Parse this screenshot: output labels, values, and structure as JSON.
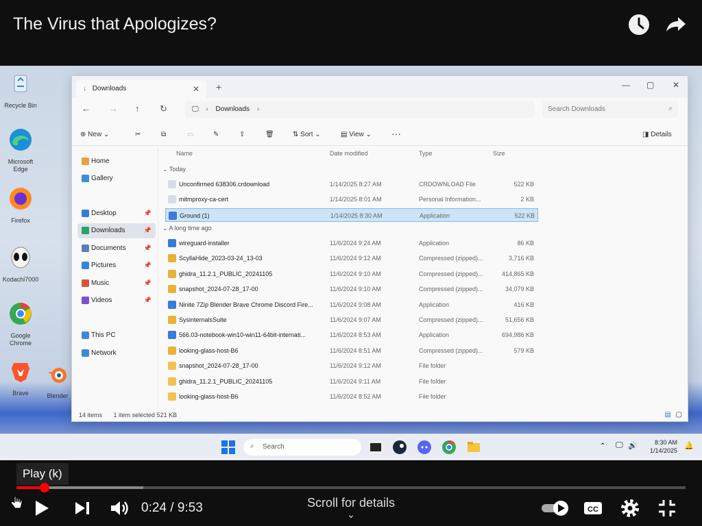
{
  "player": {
    "title": "The Virus that Apologizes?",
    "tooltip": "Play (k)",
    "time": "0:24 / 9:53",
    "scroll_hint": "Scroll for details",
    "played_fraction": 0.042,
    "buffered_fraction": 0.19,
    "icons": [
      "watch-later-icon",
      "share-icon",
      "play-icon",
      "next-icon",
      "volume-icon",
      "autoplay-toggle-icon",
      "cc-icon",
      "settings-icon",
      "exit-fullscreen-icon",
      "chevron-down-icon",
      "hand-cursor-icon"
    ]
  },
  "desktop": {
    "icons": [
      {
        "label": "Recycle Bin"
      },
      {
        "label": "Microsoft Edge"
      },
      {
        "label": "Firefox"
      },
      {
        "label": "Kodachi7000"
      },
      {
        "label": "Google Chrome"
      },
      {
        "label": "Brave"
      },
      {
        "label": "Blender"
      }
    ]
  },
  "explorer": {
    "tab_label": "Downloads",
    "breadcrumb": "Downloads",
    "search_placeholder": "Search Downloads",
    "toolbar": {
      "new": "New",
      "sort": "Sort",
      "view": "View",
      "details": "Details"
    },
    "sidebar": {
      "top": [
        {
          "label": "Home"
        },
        {
          "label": "Gallery"
        }
      ],
      "pinned": [
        {
          "label": "Desktop"
        },
        {
          "label": "Downloads"
        },
        {
          "label": "Documents"
        },
        {
          "label": "Pictures"
        },
        {
          "label": "Music"
        },
        {
          "label": "Videos"
        }
      ],
      "bottom": [
        {
          "label": "This PC"
        },
        {
          "label": "Network"
        }
      ]
    },
    "columns": {
      "name": "Name",
      "date": "Date modified",
      "type": "Type",
      "size": "Size"
    },
    "groups": {
      "today": "Today",
      "older": "A long time ago"
    },
    "today_rows": [
      {
        "name": "Unconfirmed 638306.crdownload",
        "date": "1/14/2025 8:27 AM",
        "type": "CRDOWNLOAD File",
        "size": "522 KB"
      },
      {
        "name": "mitmproxy-ca-cert",
        "date": "1/14/2025 8:01 AM",
        "type": "Personal Information...",
        "size": "2 KB"
      },
      {
        "name": "Ground (1)",
        "date": "1/14/2025 8:30 AM",
        "type": "Application",
        "size": "522 KB"
      }
    ],
    "older_rows": [
      {
        "name": "wireguard-installer",
        "date": "11/6/2024 9:24 AM",
        "type": "Application",
        "size": "86 KB"
      },
      {
        "name": "ScyllaHide_2023-03-24_13-03",
        "date": "11/6/2024 9:12 AM",
        "type": "Compressed (zipped)...",
        "size": "3,716 KB"
      },
      {
        "name": "ghidra_11.2.1_PUBLIC_20241105",
        "date": "11/6/2024 9:10 AM",
        "type": "Compressed (zipped)...",
        "size": "414,865 KB"
      },
      {
        "name": "snapshot_2024-07-28_17-00",
        "date": "11/6/2024 9:10 AM",
        "type": "Compressed (zipped)...",
        "size": "34,079 KB"
      },
      {
        "name": "Ninite 7Zip Blender Brave Chrome Discord Fire...",
        "date": "11/6/2024 9:08 AM",
        "type": "Application",
        "size": "416 KB"
      },
      {
        "name": "SysinternalsSuite",
        "date": "11/6/2024 9:07 AM",
        "type": "Compressed (zipped)...",
        "size": "51,656 KB"
      },
      {
        "name": "566.03-notebook-win10-win11-64bit-internati...",
        "date": "11/6/2024 8:53 AM",
        "type": "Application",
        "size": "694,986 KB"
      },
      {
        "name": "looking-glass-host-B6",
        "date": "11/6/2024 8:51 AM",
        "type": "Compressed (zipped)...",
        "size": "579 KB"
      },
      {
        "name": "snapshot_2024-07-28_17-00",
        "date": "11/6/2024 9:12 AM",
        "type": "File folder",
        "size": ""
      },
      {
        "name": "ghidra_11.2.1_PUBLIC_20241105",
        "date": "11/6/2024 9:11 AM",
        "type": "File folder",
        "size": ""
      },
      {
        "name": "looking-glass-host-B6",
        "date": "11/6/2024 8:52 AM",
        "type": "File folder",
        "size": ""
      }
    ],
    "status_count": "14 items",
    "status_selected": "1 item selected  521 KB"
  },
  "taskbar": {
    "search_label": "Search",
    "time": "8:30 AM",
    "date": "1/14/2025"
  },
  "colors": {
    "accent": "#ff0000",
    "selection": "#cce4f7"
  }
}
